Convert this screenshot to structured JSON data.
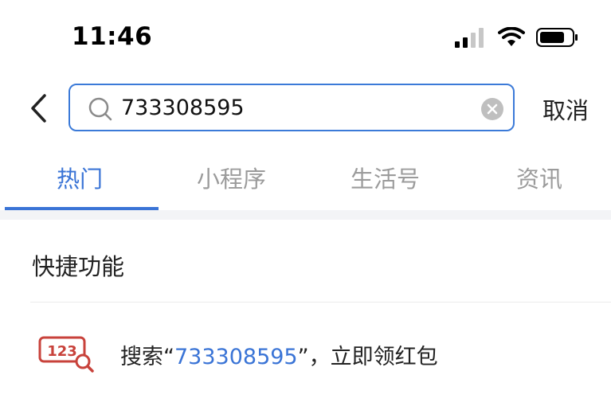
{
  "status_bar": {
    "time": "11:46",
    "icons": [
      "signal-icon",
      "wifi-icon",
      "battery-icon"
    ]
  },
  "search": {
    "value": "733308595",
    "cancel_label": "取消"
  },
  "tabs": [
    {
      "label": "热门",
      "active": true
    },
    {
      "label": "小程序",
      "active": false
    },
    {
      "label": "生活号",
      "active": false
    },
    {
      "label": "资讯",
      "active": false
    }
  ],
  "quick_functions": {
    "title": "快捷功能",
    "items": [
      {
        "icon": "number-search-icon",
        "icon_text": "123",
        "prefix": "搜索“",
        "highlight": "733308595",
        "suffix": "”，立即领红包"
      }
    ]
  },
  "colors": {
    "accent": "#3a74d6",
    "icon_red": "#c8423b",
    "inactive_tab": "#9b9b9b"
  }
}
